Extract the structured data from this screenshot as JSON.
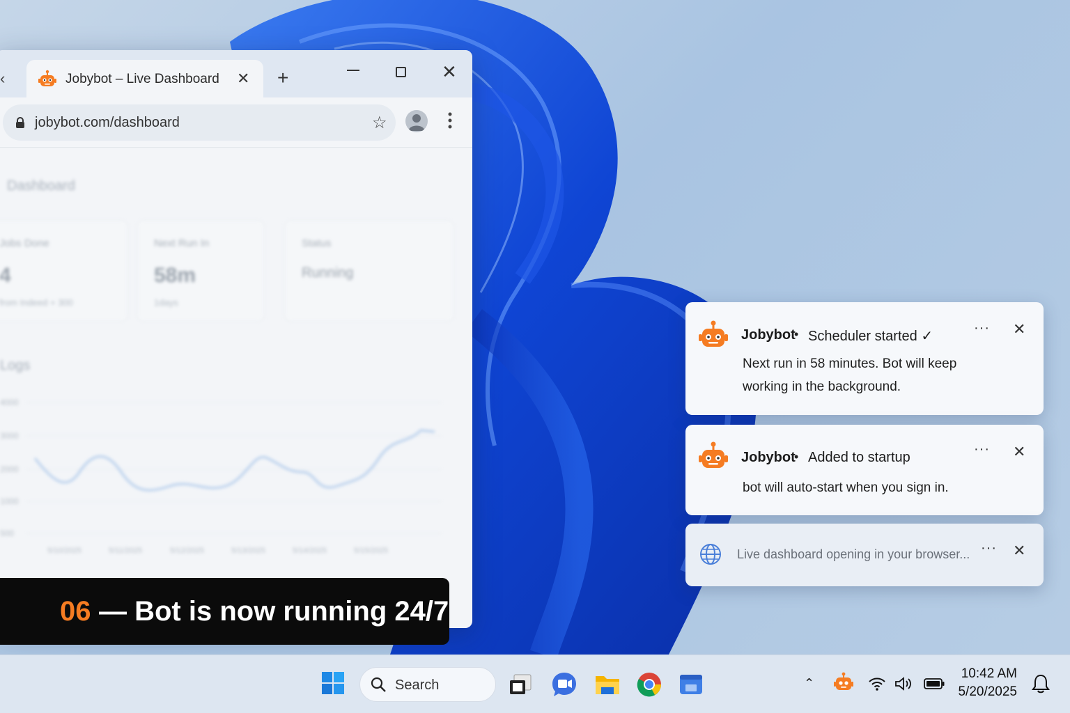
{
  "browser": {
    "tab_title": "Jobybot – Live Dashboard",
    "new_tab_glyph": "+",
    "url": "jobybot.com/dashboard",
    "page": {
      "title": "Dashboard",
      "cards": [
        {
          "label": "Jobs Done",
          "value": "4",
          "sub": "from Indeed + 300"
        },
        {
          "label": "Next Run In",
          "value": "58m",
          "sub": "1days"
        },
        {
          "label": "Status",
          "value": "Running",
          "sub": ""
        }
      ],
      "logs_title": "Logs",
      "chart": {
        "y_ticks": [
          "4000",
          "3000",
          "2000",
          "1000",
          "500"
        ],
        "x_ticks": [
          "5/10/2025",
          "5/11/2025",
          "5/12/2025",
          "5/13/2025",
          "5/14/2025",
          "5/15/2025"
        ]
      }
    }
  },
  "caption": {
    "number": "06",
    "text": "— Bot is now running 24/7",
    "number_color": "#f57c22"
  },
  "notifications": [
    {
      "app": "Jobybot",
      "headline": "Scheduler started ✓",
      "body": "Next run in 58 minutes. Bot will keep working in the background.",
      "icon": "robot-icon"
    },
    {
      "app": "Jobybot",
      "headline": "Added to startup",
      "body": "bot will auto-start when you sign in.",
      "icon": "robot-icon"
    },
    {
      "text": "Live dashboard opening in your browser...",
      "icon": "globe-icon"
    }
  ],
  "taskbar": {
    "search_label": "Search",
    "time": "10:42 AM",
    "date": "5/20/2025",
    "apps": [
      "task-view-icon",
      "teams-icon",
      "file-explorer-icon",
      "chrome-icon",
      "app-icon"
    ]
  },
  "colors": {
    "accent_orange": "#f57c22",
    "wallpaper_blue": "#1646d6"
  }
}
